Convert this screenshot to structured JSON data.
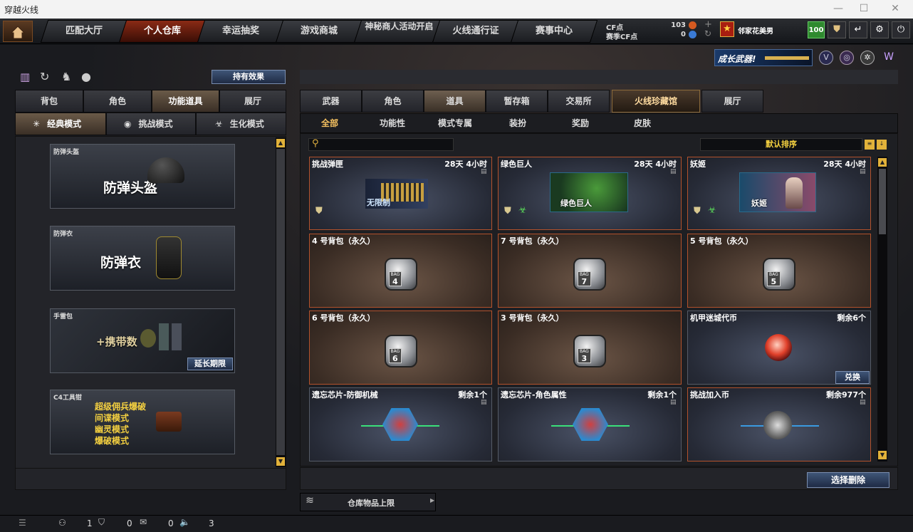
{
  "window": {
    "title": "穿越火线"
  },
  "nav": {
    "tabs": [
      "匹配大厅",
      "个人仓库",
      "幸运抽奖",
      "游戏商城",
      "神秘商人活动开启",
      "火线通行证",
      "赛事中心"
    ],
    "cf_label": "CF点",
    "cf_value": "103",
    "match_cf_label": "赛季CF点",
    "match_cf_value": "0",
    "username": "邻家花美男",
    "level": "100"
  },
  "banner": {
    "text": "成长武器!"
  },
  "left": {
    "effects_button": "持有效果",
    "tabs": [
      "背包",
      "角色",
      "功能道具",
      "展厅"
    ],
    "modes": [
      "经典模式",
      "挑战模式",
      "生化模式"
    ],
    "slots": [
      {
        "label": "防弹头盔",
        "big": "防弹头盔"
      },
      {
        "label": "防弹衣",
        "big": "防弹衣"
      },
      {
        "label": "手雷包",
        "big": "+携带数",
        "button": "延长期限"
      },
      {
        "label": "C4工具钳",
        "modes": [
          "超级佣兵爆破",
          "间谍模式",
          "幽灵模式",
          "爆破模式"
        ]
      }
    ]
  },
  "right": {
    "tabs": [
      "武器",
      "角色",
      "道具",
      "暂存箱",
      "交易所",
      "火线珍藏馆",
      "展厅"
    ],
    "subtabs": [
      "全部",
      "功能性",
      "模式专属",
      "装扮",
      "奖励",
      "皮肤"
    ],
    "sort_label": "默认排序",
    "items": [
      {
        "name": "挑战弹匣",
        "time": "28天 4小时",
        "caption": "无限制"
      },
      {
        "name": "绿色巨人",
        "time": "28天 4小时",
        "caption": "绿色巨人"
      },
      {
        "name": "妖姬",
        "time": "28天 4小时",
        "caption": "妖姬"
      },
      {
        "name": "4 号背包（永久）",
        "bag": "4"
      },
      {
        "name": "7 号背包（永久）",
        "bag": "7"
      },
      {
        "name": "5 号背包（永久）",
        "bag": "5"
      },
      {
        "name": "6 号背包（永久）",
        "bag": "6"
      },
      {
        "name": "3 号背包（永久）",
        "bag": "3"
      },
      {
        "name": "机甲迷城代币",
        "count": "剩余6个",
        "button": "兑换"
      },
      {
        "name": "遗忘芯片-防御机械",
        "count": "剩余1个"
      },
      {
        "name": "遗忘芯片-角色属性",
        "count": "剩余1个"
      },
      {
        "name": "挑战加入币",
        "count": "剩余977个"
      }
    ],
    "bag_label": "BAG",
    "delete_button": "选择删除",
    "storage_limit": "仓库物品上限"
  },
  "status": {
    "friends": "1",
    "shield": "0",
    "chat": "0",
    "volume": "3"
  },
  "colors": {
    "accent": "#b3522c",
    "active_tab": "#8a2a15",
    "gold": "#f4c060"
  }
}
